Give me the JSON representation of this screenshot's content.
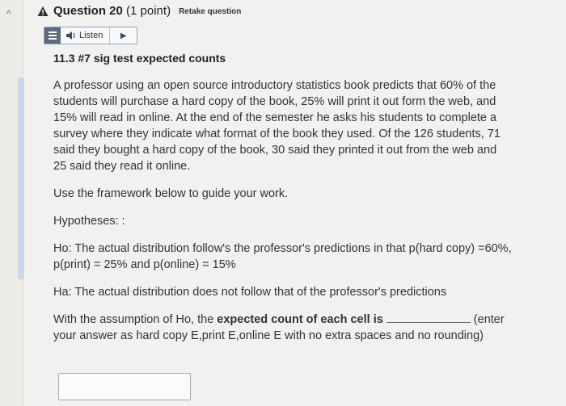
{
  "header": {
    "question_label": "Question 20",
    "points": "(1 point)",
    "retake": "Retake question"
  },
  "toolbar": {
    "listen_label": "Listen"
  },
  "question": {
    "subtitle": "11.3 #7 sig test expected counts",
    "paragraph": "A professor using an open source introductory statistics book predicts that 60% of the students will purchase a hard copy of the book, 25% will print it out form the web, and 15% will read in online. At the end of the semester he asks his students to complete a survey where they indicate what format of the book they used. Of the 126 students, 71 said they bought a hard copy of the book, 30 said they printed it out from the web and 25 said they read it online.",
    "framework": "Use the framework below to guide your work.",
    "hypotheses_label": "Hypotheses: :",
    "h0": "Ho: The actual distribution follow's the professor's predictions in that p(hard copy) =60%, p(print) = 25% and p(online) = 15%",
    "ha": "Ha: The actual distribution does not follow that of the professor's predictions",
    "prompt_before": "With the assumption of Ho, the",
    "prompt_bold": "expected count of each cell is",
    "prompt_after": "(enter your answer as hard copy E,print E,online E with no extra spaces and no rounding)"
  },
  "answer": {
    "value": ""
  },
  "colors": {
    "warning_icon": "#2f2f2f",
    "toolbar_border": "#8ea3bf",
    "background": "#f2f1ef"
  },
  "icons": {
    "warning": "warning-triangle-icon",
    "menu": "menu-icon",
    "speaker": "speaker-icon",
    "play": "play-icon"
  }
}
